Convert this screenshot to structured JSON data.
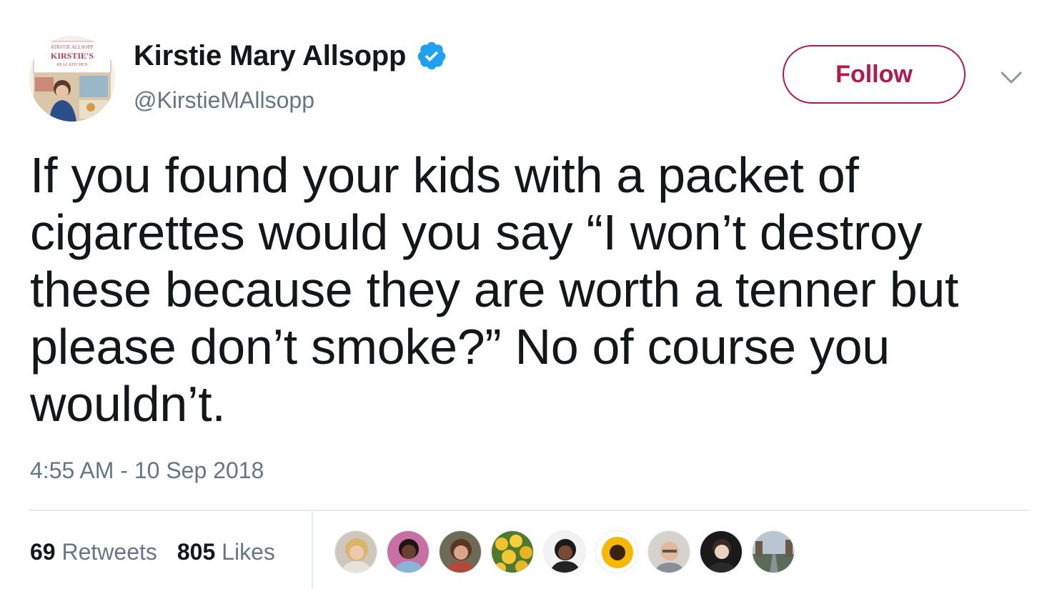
{
  "author": {
    "display_name": "Kirstie Mary Allsopp",
    "handle": "@KirstieMAllsopp",
    "verified": true,
    "avatar_icon": "avatar-book-cover",
    "avatar_text_top": "KIRSTIE ALLSOPP",
    "avatar_text_title": "KIRSTIE'S",
    "avatar_text_sub": "REAL KITCHEN"
  },
  "actions": {
    "follow_label": "Follow",
    "caret_icon": "chevron-down-icon"
  },
  "tweet": {
    "text": "If you found your kids with a packet of\ncigarettes would you say “I won’t destroy\nthese because they are worth a tenner but\nplease don’t smoke?” No of course you\nwouldn’t.",
    "timestamp": "4:55 AM - 10 Sep 2018"
  },
  "stats": {
    "retweets_count": "69",
    "retweets_label": "Retweets",
    "likes_count": "805",
    "likes_label": "Likes"
  },
  "likers": [
    {
      "icon": "avatar-blonde-woman"
    },
    {
      "icon": "avatar-dark-woman"
    },
    {
      "icon": "avatar-woman-brown-hair"
    },
    {
      "icon": "avatar-yellow-flowers"
    },
    {
      "icon": "avatar-woman-dark-hair"
    },
    {
      "icon": "avatar-sunflower"
    },
    {
      "icon": "avatar-older-man"
    },
    {
      "icon": "avatar-young-man"
    },
    {
      "icon": "avatar-street-scene"
    }
  ],
  "colors": {
    "follow_accent": "#b8174a",
    "verified_blue": "#1da1f2",
    "secondary_text": "#657786",
    "primary_text": "#14171a"
  }
}
